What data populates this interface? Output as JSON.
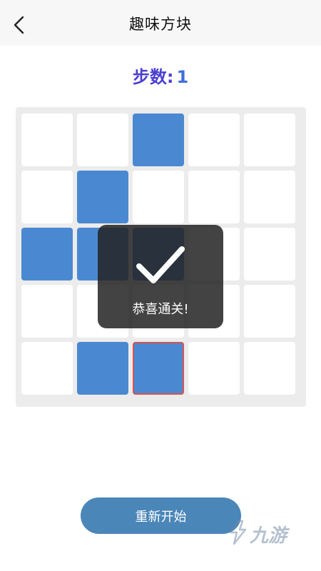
{
  "header": {
    "title": "趣味方块",
    "back_icon": "chevron-left-icon"
  },
  "game": {
    "steps_label": "步数:",
    "steps_value": "1",
    "grid": [
      [
        0,
        0,
        1,
        0,
        0
      ],
      [
        0,
        1,
        0,
        0,
        0
      ],
      [
        1,
        1,
        1,
        0,
        0
      ],
      [
        0,
        0,
        0,
        0,
        0
      ],
      [
        0,
        1,
        1,
        0,
        0
      ]
    ],
    "selected": {
      "row": 4,
      "col": 2
    },
    "colors": {
      "on": "#4a89d1",
      "off": "#ffffff",
      "selected_border": "#d9534f"
    }
  },
  "toast": {
    "icon": "check-icon",
    "message": "恭喜通关!"
  },
  "actions": {
    "restart_label": "重新开始"
  },
  "watermark": {
    "text": "九游"
  }
}
